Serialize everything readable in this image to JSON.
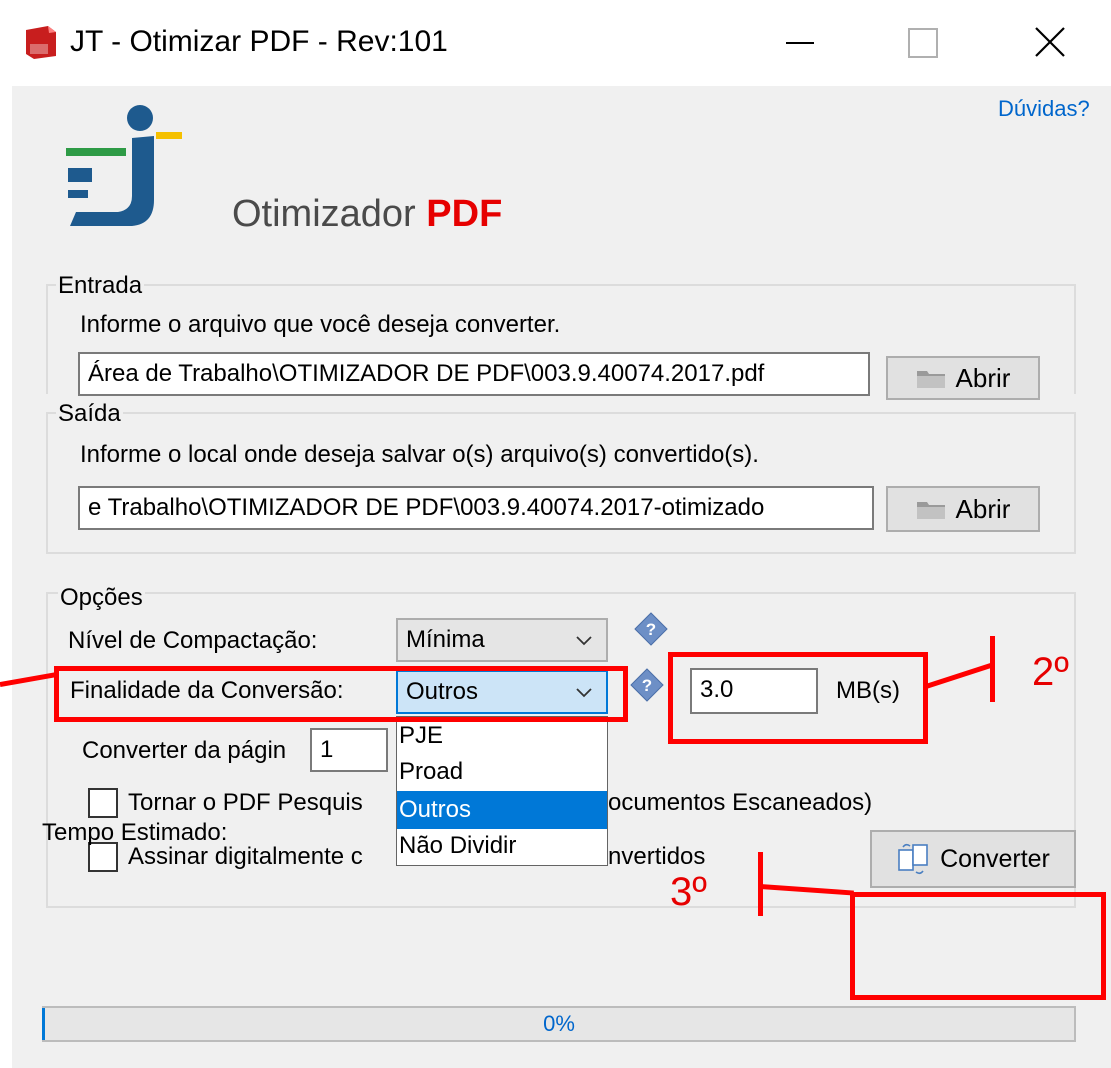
{
  "window": {
    "title": "JT - Otimizar PDF - Rev:101",
    "controls": {
      "minimize": "minimize",
      "maximize": "maximize",
      "close": "close"
    }
  },
  "header": {
    "help_link": "Dúvidas?",
    "app_title_part1": "Otimizador",
    "app_title_part2": "PDF"
  },
  "entrada": {
    "legend": "Entrada",
    "instruction": "Informe o arquivo que você deseja converter.",
    "path_value": "Área de Trabalho\\OTIMIZADOR DE PDF\\003.9.40074.2017.pdf",
    "open_button": "Abrir"
  },
  "saida": {
    "legend": "Saída",
    "instruction": "Informe o local onde deseja salvar o(s) arquivo(s) convertido(s).",
    "path_value": "e Trabalho\\OTIMIZADOR DE PDF\\003.9.40074.2017-otimizado",
    "open_button": "Abrir"
  },
  "opcoes": {
    "legend": "Opções",
    "compaction_label": "Nível de Compactação:",
    "compaction_value": "Mínima",
    "purpose_label": "Finalidade da Conversão:",
    "purpose_value": "Outros",
    "size_value": "3.0",
    "size_unit": "MB(s)",
    "page_label": "Converter da págin",
    "page_value": "1",
    "searchable_label_left": "Tornar o PDF Pesquis",
    "searchable_label_right": "ocumentos Escaneados)",
    "sign_label_left": "Assinar digitalmente c",
    "sign_label_right": "nvertidos",
    "searchable_checked": false,
    "sign_checked": false
  },
  "dropdown": {
    "options": [
      "PJE",
      "Proad",
      "Outros",
      "Não Dividir"
    ],
    "selected_index": 2
  },
  "convert_button": "Converter",
  "estimated_time_label": "Tempo Estimado:",
  "progress": {
    "text": "0%",
    "value": 0
  },
  "annotations": {
    "step2": "2º",
    "step3": "3º"
  },
  "colors": {
    "accent": "#0078d7",
    "annotation_red": "#ff0000",
    "pdf_red": "#e60000",
    "logo_blue": "#1e5a8e",
    "logo_green": "#2e9b46",
    "logo_yellow": "#f5c000"
  },
  "icons": [
    "pdf-app-icon",
    "folder-icon",
    "help-diamond-icon",
    "convert-icon",
    "chevron-down-icon",
    "close-icon"
  ]
}
